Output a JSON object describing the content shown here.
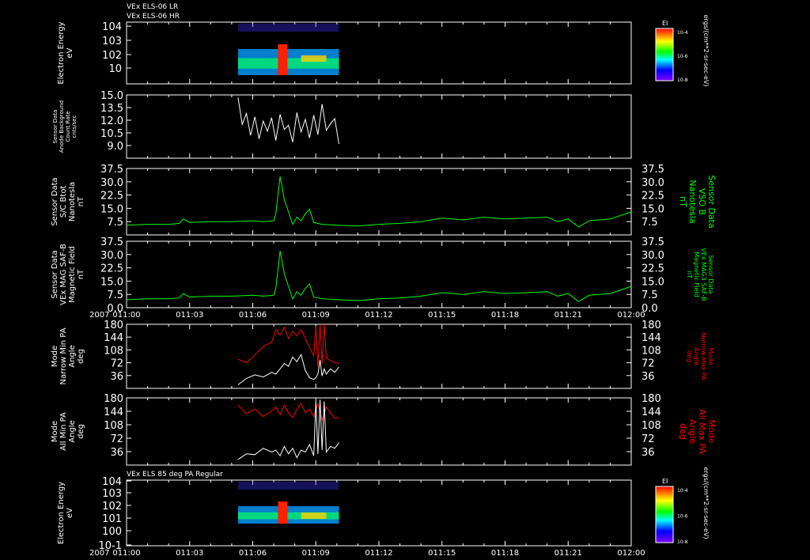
{
  "header": {
    "top_titles": [
      "VEx ELS-06 LR",
      "VEx ELS-06 HR"
    ],
    "bottom_title": "VEx ELS 85 deg PA Regular",
    "year_label": "2007"
  },
  "time_axis": {
    "ticks": [
      "011:00",
      "011:03",
      "011:06",
      "011:09",
      "011:12",
      "011:15",
      "011:18",
      "011:21",
      "012:00"
    ]
  },
  "colors": {
    "background": "#000000",
    "trace_white": "#ffffff",
    "trace_green": "#00ff00",
    "trace_red": "#ff0000"
  },
  "chart_data": [
    {
      "type": "heatmap",
      "id": "els-hr",
      "ylabel_lines": [
        "Electron Energy",
        "eV"
      ],
      "yticks": [
        "10",
        "10^2",
        "10^3",
        "10^4"
      ],
      "colorbar": {
        "title": "EI",
        "ticks": [
          "10^-4",
          "10^-6",
          "10^-8"
        ],
        "unit": "ergs/(cm**2-sr-sec-eV)"
      }
    },
    {
      "type": "line",
      "id": "background-count",
      "ylabel_lines": [
        "Sensor Data",
        "Anode Background",
        "Count Rate",
        "cnts/sec"
      ],
      "ylim": [
        7.5,
        15.0
      ],
      "yticks": [
        "9.0",
        "10.5",
        "12.0",
        "13.5",
        "15.0"
      ],
      "series": [
        {
          "color": "white",
          "t": [
            5.3,
            5.5,
            5.7,
            5.9,
            6.1,
            6.3,
            6.5,
            6.7,
            6.9,
            7.1,
            7.3,
            7.5,
            7.7,
            7.9,
            8.1,
            8.3,
            8.5,
            8.7,
            8.9,
            9.1,
            9.3,
            9.5,
            9.7,
            9.9,
            10.1
          ],
          "values": [
            14.7,
            11.5,
            12.8,
            10.2,
            12.4,
            9.8,
            11.9,
            10.7,
            12.3,
            9.6,
            12.7,
            10.9,
            11.4,
            9.4,
            12.9,
            10.6,
            12.1,
            9.9,
            12.6,
            10.3,
            13.9,
            10.8,
            11.6,
            12.2,
            9.2
          ]
        }
      ]
    },
    {
      "type": "line",
      "id": "bmag-sc",
      "ylabel_lines": [
        "Sensor Data",
        "S/C Btot",
        "Nanotesla",
        "nT"
      ],
      "ylabel_right_lines": [
        "Sensor Data",
        "VSO B",
        "Nanotesla",
        "nT"
      ],
      "ylim": [
        0,
        37.5
      ],
      "yticks": [
        "7.5",
        "15.0",
        "22.5",
        "30.0",
        "37.5"
      ],
      "series": [
        {
          "color": "green",
          "t": [
            0,
            1,
            2,
            2.5,
            2.7,
            3,
            4,
            5,
            6,
            6.5,
            7.0,
            7.1,
            7.3,
            7.5,
            7.7,
            7.9,
            8.1,
            8.3,
            8.5,
            8.7,
            8.9,
            9.3,
            10,
            11,
            12,
            13,
            14,
            15,
            16,
            17,
            18,
            19,
            20,
            20.5,
            21,
            21.5,
            22,
            23,
            24
          ],
          "values": [
            5.5,
            6,
            6,
            6.5,
            9,
            7,
            7.5,
            7.5,
            8,
            7.5,
            8,
            12,
            33,
            20,
            13,
            6,
            10,
            8,
            12,
            14.5,
            7,
            6,
            5.5,
            5,
            6,
            6.5,
            7.5,
            9.5,
            8.5,
            10,
            9,
            9.5,
            10,
            7.5,
            9,
            4.5,
            8,
            9,
            13
          ]
        }
      ]
    },
    {
      "type": "line",
      "id": "mag3",
      "ylabel_lines": [
        "Sensor Data",
        "VEx MAG SAF-B",
        "Magnetic Field",
        "nT"
      ],
      "ylabel_right_lines": [
        "Sensor Data",
        "VEx MAG3 SAF-B",
        "Magnetic Field",
        "nT"
      ],
      "ylim": [
        0,
        37.5
      ],
      "yticks": [
        "0.0",
        "7.5",
        "15.0",
        "22.5",
        "30.0",
        "37.5"
      ],
      "series": [
        {
          "color": "green",
          "t": [
            0,
            1,
            2,
            2.5,
            2.7,
            3,
            4,
            5,
            6,
            6.5,
            7.0,
            7.1,
            7.3,
            7.5,
            7.7,
            7.9,
            8.1,
            8.3,
            8.5,
            8.7,
            8.9,
            9.3,
            10,
            11,
            12,
            13,
            14,
            15,
            16,
            17,
            18,
            19,
            20,
            20.5,
            21,
            21.5,
            22,
            23,
            24
          ],
          "values": [
            4.5,
            5,
            5,
            5.5,
            8,
            6,
            6.5,
            6.5,
            7,
            6.5,
            7,
            11,
            32,
            19,
            12,
            5,
            9,
            7,
            11,
            13.5,
            6,
            5,
            4.5,
            4,
            5,
            5.5,
            6.5,
            8.5,
            7.5,
            9,
            8,
            8.5,
            9,
            6.5,
            8,
            3.5,
            7,
            8,
            12
          ]
        }
      ]
    },
    {
      "type": "line",
      "id": "narrow-pa",
      "ylabel_lines": [
        "Mode",
        "Narrow Min PA",
        "Angle",
        "deg"
      ],
      "ylabel_right_lines": [
        "Mode",
        "Narrow Max PA",
        "Angle",
        "deg"
      ],
      "ylim": [
        0,
        180
      ],
      "yticks": [
        "36",
        "72",
        "108",
        "144",
        "180"
      ],
      "series": [
        {
          "color": "red",
          "t": [
            5.3,
            5.7,
            6.1,
            6.5,
            6.9,
            7.1,
            7.3,
            7.5,
            7.7,
            7.9,
            8.1,
            8.3,
            8.5,
            8.7,
            8.9,
            9.0,
            9.1,
            9.2,
            9.3,
            9.4,
            9.5,
            9.7,
            9.9,
            10.1
          ],
          "values": [
            82,
            72,
            95,
            118,
            130,
            165,
            150,
            172,
            140,
            160,
            148,
            165,
            140,
            115,
            92,
            175,
            60,
            180,
            70,
            180,
            85,
            78,
            72,
            70
          ]
        },
        {
          "color": "white",
          "t": [
            5.3,
            5.7,
            6.1,
            6.5,
            6.9,
            7.1,
            7.3,
            7.5,
            7.7,
            7.9,
            8.1,
            8.3,
            8.5,
            8.7,
            8.9,
            9.0,
            9.1,
            9.2,
            9.3,
            9.4,
            9.5,
            9.7,
            9.9,
            10.1
          ],
          "values": [
            10,
            28,
            38,
            32,
            45,
            40,
            55,
            70,
            62,
            88,
            75,
            95,
            50,
            30,
            25,
            30,
            40,
            80,
            35,
            55,
            40,
            55,
            45,
            60
          ]
        }
      ]
    },
    {
      "type": "line",
      "id": "all-pa",
      "ylabel_lines": [
        "Mode",
        "All Min PA",
        "Angle",
        "deg"
      ],
      "ylabel_right_lines": [
        "Mode",
        "All Max PA",
        "Angle",
        "deg"
      ],
      "ylim": [
        0,
        180
      ],
      "yticks": [
        "36",
        "72",
        "108",
        "144",
        "180"
      ],
      "series": [
        {
          "color": "red",
          "t": [
            5.3,
            5.7,
            6.1,
            6.5,
            6.9,
            7.1,
            7.3,
            7.5,
            7.7,
            7.9,
            8.1,
            8.3,
            8.5,
            8.7,
            8.9,
            9.1,
            9.3,
            9.5,
            9.7,
            9.9,
            10.1
          ],
          "values": [
            160,
            138,
            150,
            130,
            145,
            155,
            135,
            160,
            140,
            128,
            150,
            165,
            140,
            150,
            130,
            165,
            120,
            155,
            140,
            125,
            128
          ]
        },
        {
          "color": "white",
          "t": [
            5.3,
            5.7,
            6.1,
            6.5,
            6.9,
            7.1,
            7.3,
            7.5,
            7.7,
            7.9,
            8.1,
            8.3,
            8.5,
            8.7,
            8.9,
            9.0,
            9.1,
            9.2,
            9.3,
            9.4,
            9.5,
            9.7,
            9.9,
            10.1
          ],
          "values": [
            15,
            30,
            28,
            45,
            35,
            40,
            25,
            50,
            30,
            45,
            20,
            40,
            35,
            55,
            25,
            170,
            30,
            175,
            40,
            170,
            35,
            50,
            45,
            60
          ]
        }
      ]
    },
    {
      "type": "heatmap",
      "id": "els-85pa",
      "ylabel_lines": [
        "Electron Energy",
        "eV"
      ],
      "yticks": [
        "10^-1",
        "10^0",
        "10^1",
        "10^2",
        "10^3",
        "10^4"
      ],
      "colorbar": {
        "title": "EI",
        "ticks": [
          "10^-4",
          "10^-6",
          "10^-8"
        ],
        "unit": "ergs/(cm**2-sr-sec-eV)"
      }
    }
  ]
}
